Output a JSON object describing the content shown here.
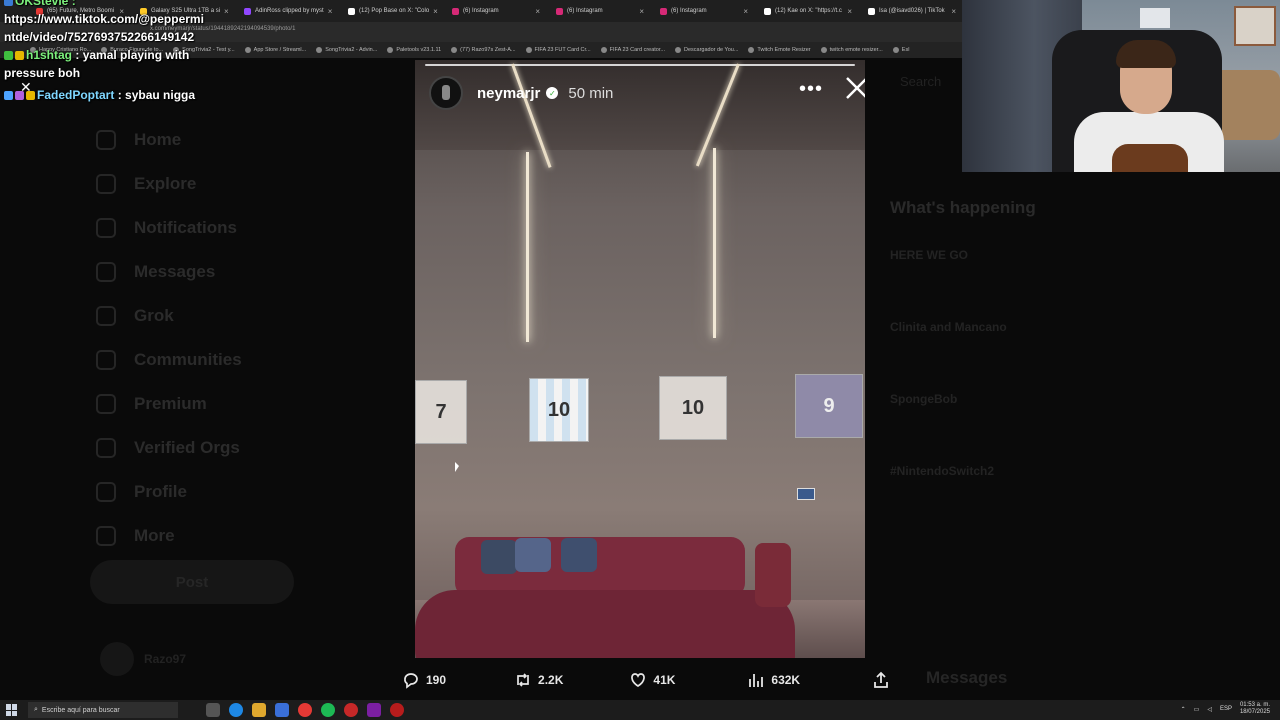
{
  "browser": {
    "tabs": [
      {
        "label": "(65) Future, Metro Boomi",
        "color": "#e53935"
      },
      {
        "label": "Galaxy S25 Ultra 1TB a si",
        "color": "#ffca28"
      },
      {
        "label": "AdinRoss clipped by myst",
        "color": "#9147ff"
      },
      {
        "label": "(12) Pop Base on X: \"Colo",
        "color": "#ffffff"
      },
      {
        "label": "(6) Instagram",
        "color": "#d62976"
      },
      {
        "label": "(6) Instagram",
        "color": "#d62976"
      },
      {
        "label": "(6) Instagram",
        "color": "#d62976"
      },
      {
        "label": "(12) Kae on X: \"https://t.c",
        "color": "#ffffff"
      },
      {
        "label": "Isa (@isavd026) | TikTok",
        "color": "#ffffff"
      }
    ],
    "url": "x.com/neymarjr/status/1944189242194094539/photo/1",
    "bookmarks": [
      "Happy Cristiano Ro...",
      "Buraco Figure de to...",
      "SongTrivia2 - Test y...",
      "App Store / Streaml...",
      "SongTrivia2 - Advin...",
      "Paletools v23.1.11",
      "(77) Razo97s Zest-A...",
      "FIFA 23 FUT Card Cr...",
      "FIFA 23 Card creator...",
      "Descargador de You...",
      "Twitch Emote Resizer",
      "twitch emote resizer...",
      "Esl"
    ]
  },
  "chat": {
    "top_name": "OKStevie :",
    "link_line1": "https://www.tiktok.com/@peppermi",
    "link_line2": "ntde/video/7527693752266149142",
    "msg1_user": "h1shtag",
    "msg1_text": ": yamal playing with",
    "msg1_cont": "pressure boh",
    "msg2_user": "FadedPoptart",
    "msg2_text": ": sybau nigga"
  },
  "xpage": {
    "nav": [
      "Home",
      "Explore",
      "Notifications",
      "Messages",
      "Grok",
      "Communities",
      "Premium",
      "Verified Orgs",
      "Profile",
      "More"
    ],
    "post_button": "Post",
    "profile_name": "Razo97",
    "search_placeholder": "Search",
    "trends_title": "What's happening",
    "trends": [
      "HERE WE GO",
      "Clinita and Mancano",
      "SpongeBob",
      "#NintendoSwitch2",
      ""
    ],
    "messages_label": "Messages"
  },
  "story": {
    "username": "neymarjr",
    "time": "50 min",
    "jerseys": [
      {
        "number": "7",
        "style": "white"
      },
      {
        "number": "10",
        "style": "blue"
      },
      {
        "number": "10",
        "style": "white"
      },
      {
        "number": "9",
        "style": "purple"
      }
    ]
  },
  "actions": {
    "replies": "190",
    "reposts": "2.2K",
    "likes": "41K",
    "views": "632K"
  },
  "taskbar": {
    "search_placeholder": "Escribe aquí para buscar",
    "lang": "ESP",
    "time": "01:53 a. m.",
    "date": "18/07/2025"
  }
}
